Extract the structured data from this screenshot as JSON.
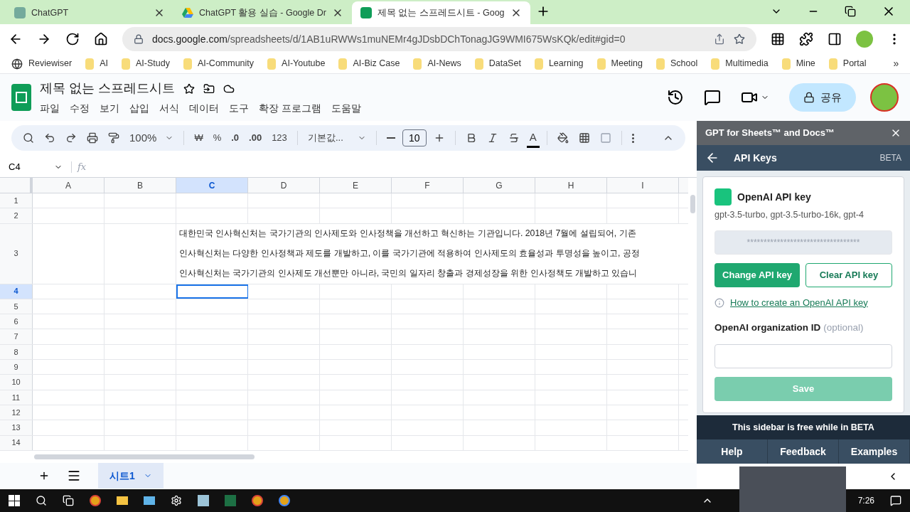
{
  "browser": {
    "tabs": [
      {
        "title": "ChatGPT",
        "selected": false
      },
      {
        "title": "ChatGPT 활용 실습 - Google Dr",
        "selected": false
      },
      {
        "title": "제목 없는 스프레드시트 - Goog",
        "selected": true
      }
    ],
    "url_host": "docs.google.com",
    "url_path": "/spreadsheets/d/1AB1uRWWs1muNEMr4gJDsbDChTonagJG9WMI675WsKQk/edit#gid=0",
    "bookmarks": [
      {
        "label": "Reviewiser",
        "kind": "site"
      },
      {
        "label": "AI",
        "kind": "folder"
      },
      {
        "label": "AI-Study",
        "kind": "folder"
      },
      {
        "label": "AI-Community",
        "kind": "folder"
      },
      {
        "label": "AI-Youtube",
        "kind": "folder"
      },
      {
        "label": "AI-Biz Case",
        "kind": "folder"
      },
      {
        "label": "AI-News",
        "kind": "folder"
      },
      {
        "label": "DataSet",
        "kind": "folder"
      },
      {
        "label": "Learning",
        "kind": "folder"
      },
      {
        "label": "Meeting",
        "kind": "folder"
      },
      {
        "label": "School",
        "kind": "folder"
      },
      {
        "label": "Multimedia",
        "kind": "folder"
      },
      {
        "label": "Mine",
        "kind": "folder"
      },
      {
        "label": "Portal",
        "kind": "folder"
      }
    ],
    "more_bookmarks": "»"
  },
  "sheets": {
    "title": "제목 없는 스프레드시트",
    "menus": [
      "파일",
      "수정",
      "보기",
      "삽입",
      "서식",
      "데이터",
      "도구",
      "확장 프로그램",
      "도움말"
    ],
    "share": "공유",
    "toolbar": {
      "zoom": "100%",
      "currency": "₩",
      "percent": "%",
      "decrease_decimal": ".0",
      "increase_decimal": ".00",
      "number_format": "123",
      "font": "기본값...",
      "font_size": "10",
      "text_color_glyph": "A"
    },
    "name_box": "C4",
    "formula_symbol": "fx",
    "columns": [
      {
        "label": "A",
        "selected": false
      },
      {
        "label": "B",
        "selected": false
      },
      {
        "label": "C",
        "selected": true
      },
      {
        "label": "D",
        "selected": false
      },
      {
        "label": "E",
        "selected": false
      },
      {
        "label": "F",
        "selected": false
      },
      {
        "label": "G",
        "selected": false
      },
      {
        "label": "H",
        "selected": false
      },
      {
        "label": "I",
        "selected": false
      }
    ],
    "rows": [
      {
        "label": "1",
        "selected": false
      },
      {
        "label": "2",
        "selected": false
      },
      {
        "label": "3",
        "selected": false,
        "lines": [
          "대한민국 인사혁신처는 국가기관의 인사제도와 인사정책을 개선하고 혁신하는 기관입니다. 2018년 7월에 설립되어, 기존",
          "인사혁신처는 다양한 인사정책과 제도를 개발하고, 이를 국가기관에 적용하여 인사제도의 효율성과 투명성을 높이고, 공정",
          "인사혁신처는 국가기관의 인사제도 개선뿐만 아니라, 국민의 일자리 창출과 경제성장을 위한 인사정책도 개발하고 있습니"
        ]
      },
      {
        "label": "4",
        "selected": true
      },
      {
        "label": "5",
        "selected": false
      },
      {
        "label": "6",
        "selected": false
      },
      {
        "label": "7",
        "selected": false
      },
      {
        "label": "8",
        "selected": false
      },
      {
        "label": "9",
        "selected": false
      },
      {
        "label": "10",
        "selected": false
      },
      {
        "label": "11",
        "selected": false
      },
      {
        "label": "12",
        "selected": false
      },
      {
        "label": "13",
        "selected": false
      },
      {
        "label": "14",
        "selected": false
      }
    ],
    "sheet_tabs": [
      {
        "label": "시트1",
        "selected": true
      }
    ]
  },
  "sidebar": {
    "title": "GPT for Sheets™ and Docs™",
    "page": "API Keys",
    "badge": "BETA",
    "card": {
      "title": "OpenAI API key",
      "models": "gpt-3.5-turbo, gpt-3.5-turbo-16k, gpt-4",
      "api_key_value": "**********************************",
      "change_button": "Change API key",
      "clear_button": "Clear API key",
      "help_link": "How to create an OpenAI API key",
      "org_label": "OpenAI organization ID",
      "org_hint": "(optional)",
      "save_button": "Save",
      "save_disabled": true
    },
    "banner": "This sidebar is free while in BETA",
    "footer_buttons": [
      "Help",
      "Feedback",
      "Examples"
    ]
  },
  "taskbar": {
    "time": "7:26"
  }
}
